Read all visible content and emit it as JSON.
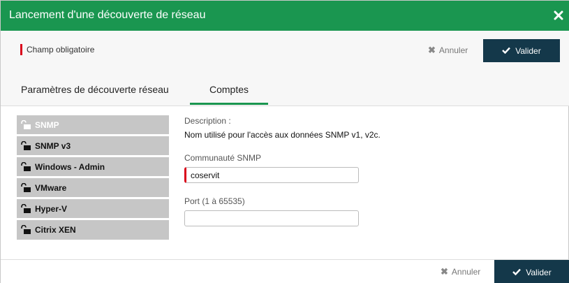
{
  "dialog": {
    "title": "Lancement d'une découverte de réseau"
  },
  "topbar": {
    "required_label": "Champ obligatoire",
    "cancel_label": "Annuler",
    "validate_label": "Valider"
  },
  "tabs": [
    {
      "label": "Paramètres de découverte réseau",
      "active": false
    },
    {
      "label": "Comptes",
      "active": true
    }
  ],
  "accounts": [
    {
      "label": "SNMP",
      "active": true
    },
    {
      "label": "SNMP v3",
      "active": false
    },
    {
      "label": "Windows - Admin",
      "active": false
    },
    {
      "label": "VMware",
      "active": false
    },
    {
      "label": "Hyper-V",
      "active": false
    },
    {
      "label": "Citrix XEN",
      "active": false
    }
  ],
  "form": {
    "description_label": "Description :",
    "description_text": "Nom utilisé pour l'accès aux données SNMP v1, v2c.",
    "community_label": "Communauté SNMP",
    "community_value": "coservit",
    "port_label": "Port (1 à 65535)",
    "port_value": ""
  },
  "bottombar": {
    "cancel_label": "Annuler",
    "validate_label": "Valider"
  },
  "colors": {
    "header_green": "#1a9650",
    "validate_navy": "#14384a",
    "required_red": "#d9001b",
    "list_gray": "#c6c6c6"
  }
}
